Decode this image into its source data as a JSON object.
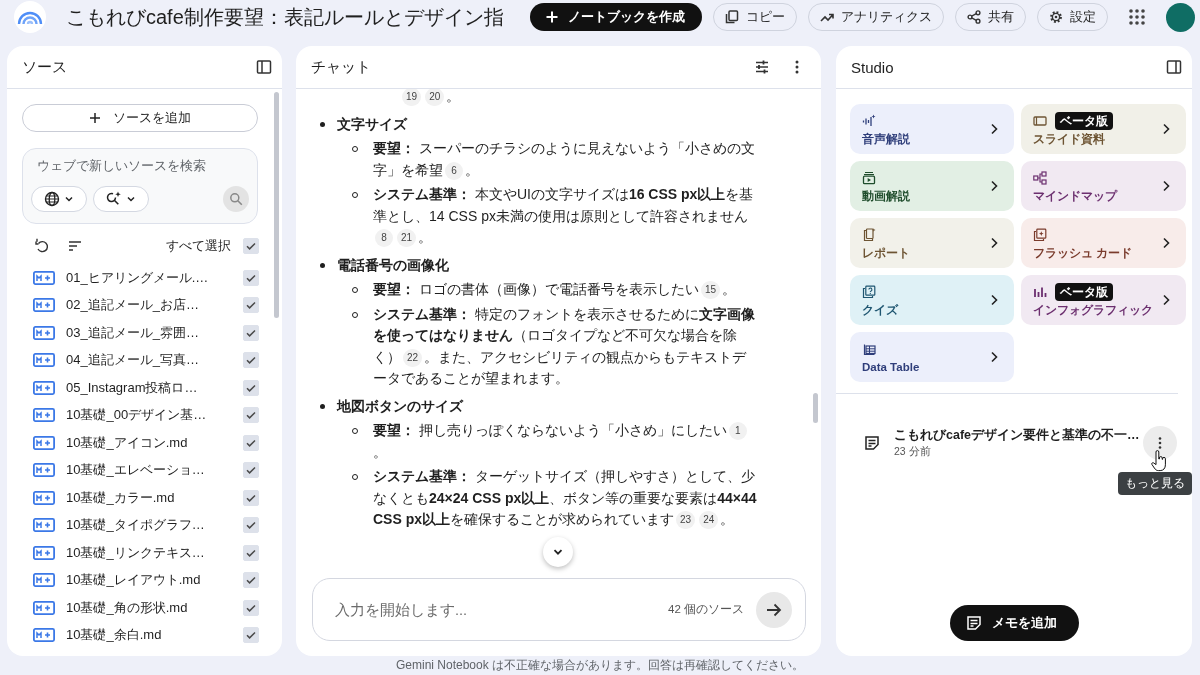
{
  "header": {
    "title": "こもれびcafe制作要望：表記ルールとデザイン指",
    "create_button": "ノートブックを作成",
    "buttons": [
      {
        "kind": "copy",
        "label": "コピー"
      },
      {
        "kind": "analytics",
        "label": "アナリティクス"
      },
      {
        "kind": "share",
        "label": "共有"
      },
      {
        "kind": "settings",
        "label": "設定"
      }
    ]
  },
  "sources": {
    "title": "ソース",
    "add_button": "ソースを追加",
    "search": {
      "placeholder": "ウェブで新しいソースを検索"
    },
    "select_all": {
      "label": "すべて選択",
      "checked": true
    },
    "items": [
      {
        "name": "01_ヒアリングメール.…",
        "checked": true
      },
      {
        "name": "02_追記メール_お店…",
        "checked": true
      },
      {
        "name": "03_追記メール_雰囲…",
        "checked": true
      },
      {
        "name": "04_追記メール_写真…",
        "checked": true
      },
      {
        "name": "05_Instagram投稿ロ…",
        "checked": true
      },
      {
        "name": "10基礎_00デザイン基…",
        "checked": true
      },
      {
        "name": "10基礎_アイコン.md",
        "checked": true
      },
      {
        "name": "10基礎_エレベーショ…",
        "checked": true
      },
      {
        "name": "10基礎_カラー.md",
        "checked": true
      },
      {
        "name": "10基礎_タイポグラフ…",
        "checked": true
      },
      {
        "name": "10基礎_リンクテキス…",
        "checked": true
      },
      {
        "name": "10基礎_レイアウト.md",
        "checked": true
      },
      {
        "name": "10基礎_角の形状.md",
        "checked": true
      },
      {
        "name": "10基礎_余白.md",
        "checked": true
      }
    ]
  },
  "chat": {
    "title": "チャット",
    "lead": {
      "citations": [
        "19",
        "20"
      ],
      "tail": "。"
    },
    "sections": [
      {
        "heading": "文字サイズ",
        "points": [
          {
            "text": "**要望：** スーパーのチラシのように見えないよう「小さめの文字」を希望",
            "citations": [
              "6"
            ],
            "tail": "。"
          },
          {
            "text": "**システム基準：** 本文やUIの文字サイズは**16 CSS px以上**を基準とし、14 CSS px未満の使用は原則として許容されません",
            "citations": [
              "8",
              "21"
            ],
            "tail": "。"
          }
        ]
      },
      {
        "heading": "電話番号の画像化",
        "points": [
          {
            "text": "**要望：** ロゴの書体（画像）で電話番号を表示したい",
            "citations": [
              "15"
            ],
            "tail": "。"
          },
          {
            "text": "**システム基準：** 特定のフォントを表示させるために**文字画像を使ってはなりません**（ロゴタイプなど不可欠な場合を除く）",
            "citations": [
              "22"
            ],
            "tail": "。また、アクセシビリティの観点からもテキストデータであることが望まれます。"
          }
        ]
      },
      {
        "heading": "地図ボタンのサイズ",
        "points": [
          {
            "text": "**要望：** 押し売りっぽくならないよう「小さめ」にしたい",
            "citations": [
              "1"
            ],
            "tail": "。"
          },
          {
            "text": "**システム基準：** ターゲットサイズ（押しやすさ）として、少なくとも**24×24 CSS px以上**、ボタン等の重要な要素は**44×44 CSS px以上**を確保することが求められています",
            "citations": [
              "23",
              "24"
            ],
            "tail": "。"
          }
        ]
      }
    ],
    "input": {
      "placeholder": "入力を開始します...",
      "source_count": "42 個のソース"
    }
  },
  "studio": {
    "title": "Studio",
    "tiles": [
      {
        "kind": "audio",
        "label": "音声解説"
      },
      {
        "kind": "video",
        "label": "動画解説"
      },
      {
        "kind": "report",
        "label": "レポート"
      },
      {
        "kind": "quiz",
        "label": "クイズ"
      },
      {
        "kind": "table",
        "label": "Data Table"
      },
      {
        "kind": "slides",
        "label": "スライド資料",
        "badge": "ベータ版"
      },
      {
        "kind": "mindmap",
        "label": "マインドマップ"
      },
      {
        "kind": "flashcards",
        "label": "フラッシュ カード"
      },
      {
        "kind": "infographic",
        "label": "インフォグラフィック",
        "badge": "ベータ版"
      }
    ],
    "notes": [
      {
        "title": "こもれびcafeデザイン要件と基準の不一…",
        "time": "23 分前"
      }
    ],
    "tooltip": "もっと見る",
    "add_note_button": "メモを追加"
  },
  "footer": "Gemini Notebook は不正確な場合があります。回答は再確認してください。"
}
